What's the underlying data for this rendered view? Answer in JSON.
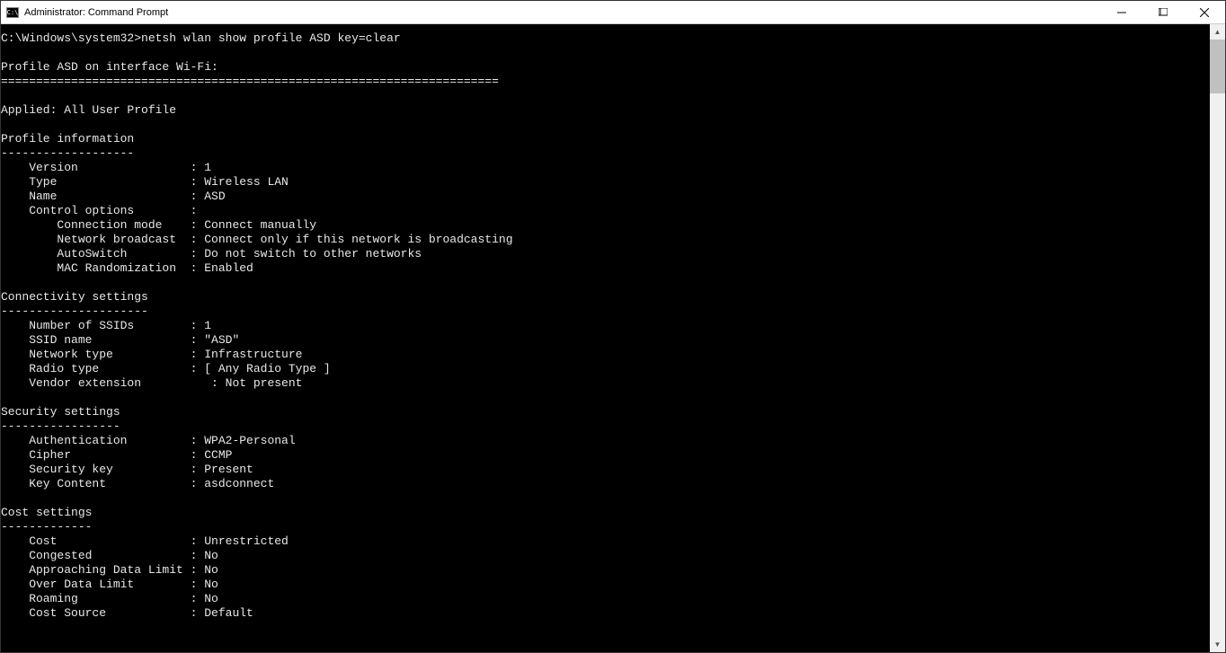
{
  "titlebar": {
    "icon_label": "C:\\",
    "title": "Administrator: Command Prompt"
  },
  "terminal": {
    "prompt": "C:\\Windows\\system32>",
    "command": "netsh wlan show profile ASD key=clear",
    "profile_header": "Profile ASD on interface Wi-Fi:",
    "divider": "=======================================================================",
    "applied_line": "Applied: All User Profile",
    "sections": {
      "profile_info": {
        "heading": "Profile information",
        "divider": "-------------------",
        "rows": [
          {
            "label": "    Version",
            "value": "1"
          },
          {
            "label": "    Type",
            "value": "Wireless LAN"
          },
          {
            "label": "    Name",
            "value": "ASD"
          },
          {
            "label": "    Control options",
            "value": ""
          },
          {
            "label": "        Connection mode",
            "value": "Connect manually"
          },
          {
            "label": "        Network broadcast",
            "value": "Connect only if this network is broadcasting"
          },
          {
            "label": "        AutoSwitch",
            "value": "Do not switch to other networks"
          },
          {
            "label": "        MAC Randomization",
            "value": "Enabled"
          }
        ]
      },
      "connectivity": {
        "heading": "Connectivity settings",
        "divider": "---------------------",
        "rows": [
          {
            "label": "    Number of SSIDs",
            "value": "1"
          },
          {
            "label": "    SSID name",
            "value": "\"ASD\""
          },
          {
            "label": "    Network type",
            "value": "Infrastructure"
          },
          {
            "label": "    Radio type",
            "value": "[ Any Radio Type ]"
          },
          {
            "label": "    Vendor extension",
            "value": "   : Not present",
            "no_colon": true
          }
        ]
      },
      "security": {
        "heading": "Security settings",
        "divider": "-----------------",
        "rows": [
          {
            "label": "    Authentication",
            "value": "WPA2-Personal"
          },
          {
            "label": "    Cipher",
            "value": "CCMP"
          },
          {
            "label": "    Security key",
            "value": "Present"
          },
          {
            "label": "    Key Content",
            "value": "asdconnect"
          }
        ]
      },
      "cost": {
        "heading": "Cost settings",
        "divider": "-------------",
        "rows": [
          {
            "label": "    Cost",
            "value": "Unrestricted"
          },
          {
            "label": "    Congested",
            "value": "No"
          },
          {
            "label": "    Approaching Data Limit",
            "value": "No"
          },
          {
            "label": "    Over Data Limit",
            "value": "No"
          },
          {
            "label": "    Roaming",
            "value": "No"
          },
          {
            "label": "    Cost Source",
            "value": "Default"
          }
        ]
      }
    }
  }
}
